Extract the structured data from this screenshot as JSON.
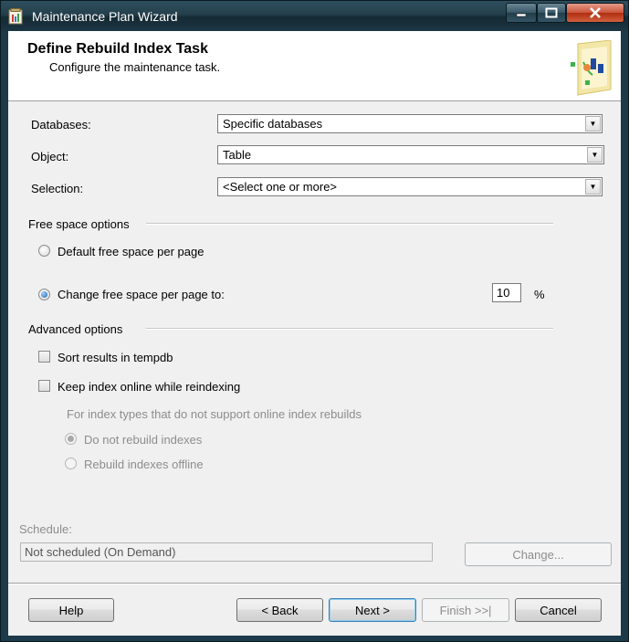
{
  "window": {
    "title": "Maintenance Plan Wizard",
    "buttons": {
      "minimize": "‒",
      "maximize": "□",
      "close": "✕"
    }
  },
  "header": {
    "title": "Define Rebuild Index Task",
    "subtitle": "Configure the maintenance task."
  },
  "form": {
    "databases": {
      "label": "Databases:",
      "value": "Specific databases"
    },
    "object": {
      "label": "Object:",
      "value": "Table"
    },
    "selection": {
      "label": "Selection:",
      "value": "<Select one or more>"
    }
  },
  "free_space": {
    "group_label": "Free space options",
    "default_option": {
      "label": "Default free space per page",
      "checked": false
    },
    "change_option": {
      "label": "Change free space per page to:",
      "checked": true
    },
    "percent_value": "10",
    "percent_unit": "%"
  },
  "advanced": {
    "group_label": "Advanced options",
    "sort_tempdb": {
      "label": "Sort results in tempdb",
      "checked": false
    },
    "keep_online": {
      "label": "Keep index online while reindexing",
      "checked": false
    },
    "online_note": "For index types that do not support online index rebuilds",
    "do_not_rebuild": {
      "label": "Do not rebuild indexes",
      "checked": true
    },
    "rebuild_offline": {
      "label": "Rebuild indexes offline",
      "checked": false
    }
  },
  "schedule": {
    "label": "Schedule:",
    "value": "Not scheduled (On Demand)",
    "change_button": "Change..."
  },
  "footer": {
    "help": "Help",
    "back": "< Back",
    "next": "Next >",
    "finish": "Finish >>|",
    "cancel": "Cancel"
  }
}
